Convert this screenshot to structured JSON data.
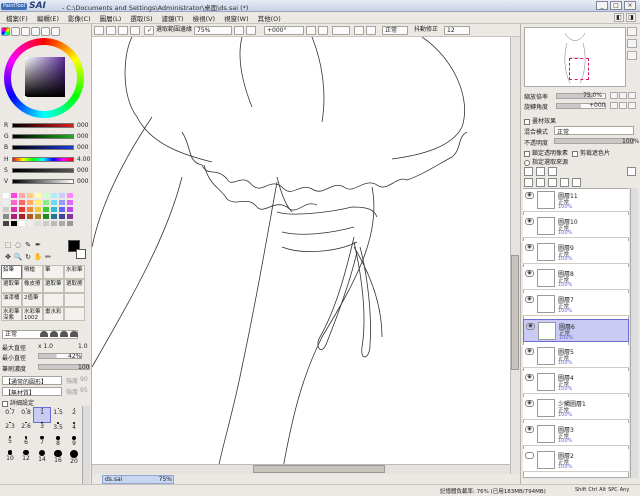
{
  "titlebar": {
    "logo_small": "PaintTool",
    "logo_sai": "SAI",
    "title": "- C:\\Documents and Settings\\Administrator\\桌面\\ds.sai (*)",
    "min": "_",
    "max": "□",
    "close": "×"
  },
  "menu": [
    "檔案(F)",
    "編輯(E)",
    "影像(C)",
    "圖層(L)",
    "選取(S)",
    "濾鏡(T)",
    "檢視(V)",
    "視窗(W)",
    "其他(O)"
  ],
  "menu_right": {
    "a": "◧",
    "b": "◨"
  },
  "toolbar": {
    "check": "✓",
    "antialias": "選取範圍邊緣",
    "zoom": "75%",
    "angle": "+000°",
    "mode": "正常",
    "stab_label": "抖動修正",
    "stab_value": "12"
  },
  "colors": {
    "sliders": [
      {
        "label": "R",
        "value": "000",
        "color": "#d02020"
      },
      {
        "label": "G",
        "value": "000",
        "color": "#20a020"
      },
      {
        "label": "B",
        "value": "000",
        "color": "#2040d0"
      },
      {
        "label": "H",
        "value": "4.00",
        "color": "hue"
      },
      {
        "label": "S",
        "value": "000",
        "color": "#888"
      },
      {
        "label": "V",
        "value": "000",
        "color": "#444"
      }
    ],
    "swatches": [
      "#fff",
      "#f4d",
      "#faa",
      "#fc8",
      "#ffa",
      "#cfc",
      "#aef",
      "#ccf",
      "#f8f",
      "#eee",
      "#f6c",
      "#f66",
      "#fa6",
      "#fe6",
      "#8e8",
      "#6df",
      "#99f",
      "#d6f",
      "#ccc",
      "#d3a",
      "#e33",
      "#e83",
      "#ec3",
      "#3c3",
      "#3bd",
      "#66e",
      "#b4e",
      "#888",
      "#a27",
      "#a22",
      "#a52",
      "#a82",
      "#282",
      "#279",
      "#449",
      "#839",
      "#444",
      "#000",
      "#fff",
      "#eee",
      "#ddd",
      "#ccc",
      "#bbb",
      "#aaa",
      "#999"
    ]
  },
  "tools": {
    "rect_select": "⬚",
    "lasso": "◌",
    "wand": "✎",
    "dropper": "✒",
    "move": "✥",
    "zoom": "🔍",
    "rotate": "↻",
    "hand": "✋",
    "pen": "✏"
  },
  "brushes": [
    {
      "label": "鉛筆",
      "sel": true
    },
    {
      "label": "噴槍"
    },
    {
      "label": "筆"
    },
    {
      "label": "水彩筆"
    },
    {
      "label": "選取筆"
    },
    {
      "label": "橡皮擦"
    },
    {
      "label": "選取筆"
    },
    {
      "label": "選取擦"
    },
    {
      "label": "油漆桶"
    },
    {
      "label": "2值筆"
    },
    {
      "label": ""
    },
    {
      "label": ""
    },
    {
      "label": "水彩筆 深紫"
    },
    {
      "label": "水彩筆 1002"
    },
    {
      "label": "畫水彩"
    },
    {
      "label": ""
    }
  ],
  "brush_props": {
    "mode": "正常",
    "max_label": "最大直徑",
    "max_mult": "x 1.0",
    "max_value": "1.0",
    "min_label": "最小直徑",
    "min_value": "42%",
    "density_label": "筆刷濃度",
    "density_value": "100",
    "shape_label": "【通常的圓形】",
    "texture_label": "【無材質】",
    "strength1": "強度",
    "s1val": "90",
    "strength2": "強度",
    "s2val": "95",
    "detail": "詳細設定"
  },
  "sizes": [
    "0.7",
    "0.8",
    "1",
    "1.5",
    "2",
    "2.3",
    "2.6",
    "3",
    "3.5",
    "4",
    "5",
    "6",
    "7",
    "8",
    "9",
    "10",
    "12",
    "14",
    "16",
    "20"
  ],
  "navigator": {
    "zoom_label": "縮放倍率",
    "zoom_value": "75.0%",
    "angle_label": "旋轉角度",
    "angle_value": "+000"
  },
  "layer_panel": {
    "effect_label": "畫材效果",
    "blend_label": "混合模式",
    "blend_value": "正常",
    "opacity_label": "不透明度",
    "opacity_value": "100%",
    "protect": "鎖定透明像素",
    "clip": "剪裁遮色片",
    "source": "指定選取來源"
  },
  "layers": [
    {
      "name": "圖層11",
      "mode": "正常",
      "opacity": "100%",
      "eye": true,
      "sel": false
    },
    {
      "name": "圖層10",
      "mode": "正常",
      "opacity": "100%",
      "eye": true,
      "sel": false
    },
    {
      "name": "圖層9",
      "mode": "正常",
      "opacity": "100%",
      "eye": true,
      "sel": false
    },
    {
      "name": "圖層8",
      "mode": "正常",
      "opacity": "100%",
      "eye": true,
      "sel": false
    },
    {
      "name": "圖層7",
      "mode": "正常",
      "opacity": "100%",
      "eye": true,
      "sel": false
    },
    {
      "name": "圖層6",
      "mode": "正常",
      "opacity": "100%",
      "eye": true,
      "sel": true
    },
    {
      "name": "圖層5",
      "mode": "正常",
      "opacity": "100%",
      "eye": true,
      "sel": false
    },
    {
      "name": "圖層4",
      "mode": "正常",
      "opacity": "100%",
      "eye": true,
      "sel": false
    },
    {
      "name": "少觸圖層1",
      "mode": "正常",
      "opacity": "100%",
      "eye": true,
      "sel": false
    },
    {
      "name": "圖層3",
      "mode": "正常",
      "opacity": "100%",
      "eye": true,
      "sel": false
    },
    {
      "name": "圖層2",
      "mode": "正常",
      "opacity": "100%",
      "eye": false,
      "sel": false
    }
  ],
  "document": {
    "file": "ds.sai",
    "zoom": "75%"
  },
  "status": {
    "memory": "記憶體負載率: 76% (已用183MB/794MB)",
    "keys": [
      "Shift",
      "Ctrl",
      "Alt",
      "SPC",
      "Any"
    ]
  }
}
